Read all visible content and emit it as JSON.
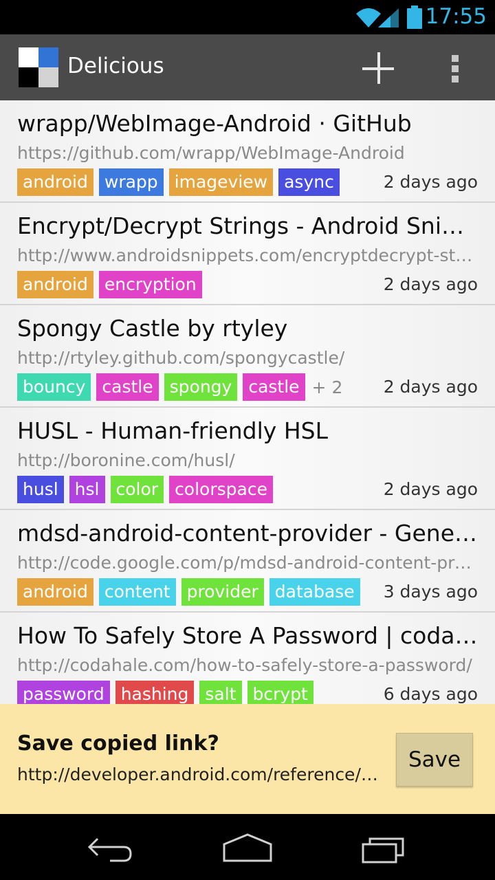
{
  "status_bar": {
    "time": "17:55",
    "icons": [
      "wifi-icon",
      "signal-icon",
      "battery-icon"
    ],
    "accent": "#33b5e5"
  },
  "action_bar": {
    "title": "Delicious",
    "icons": [
      "delicious-logo-icon",
      "add-icon",
      "overflow-menu-icon"
    ],
    "logo_colors": [
      "#3274d6",
      "#000000",
      "#d3d3d3",
      "#ffffff"
    ]
  },
  "tag_colors": {
    "orange": "#e5a43e",
    "blue": "#3c7ae0",
    "indigo": "#4a4ee0",
    "magenta": "#e042c8",
    "teal": "#3ed9b1",
    "green": "#6fe23b",
    "cyan": "#49d3ea",
    "purple": "#b042e0",
    "red": "#e04a4a",
    "violet": "#8a4ee3"
  },
  "bookmarks": [
    {
      "title": "wrapp/WebImage-Android · GitHub",
      "url": "https://github.com/wrapp/WebImage-Android",
      "tags": [
        {
          "label": "android",
          "color": "#e5a43e"
        },
        {
          "label": "wrapp",
          "color": "#3c7ae0"
        },
        {
          "label": "imageview",
          "color": "#e5a43e"
        },
        {
          "label": "async",
          "color": "#4a4ee0"
        }
      ],
      "more": "",
      "date": "2 days ago"
    },
    {
      "title": "Encrypt/Decrypt Strings - Android Snippets",
      "url": "http://www.androidsnippets.com/encryptdecrypt-strings",
      "tags": [
        {
          "label": "android",
          "color": "#e5a43e"
        },
        {
          "label": "encryption",
          "color": "#e042c8"
        }
      ],
      "more": "",
      "date": "2 days ago"
    },
    {
      "title": "Spongy Castle by rtyley",
      "url": "http://rtyley.github.com/spongycastle/",
      "tags": [
        {
          "label": "bouncy",
          "color": "#3ed9b1"
        },
        {
          "label": "castle",
          "color": "#e042c8"
        },
        {
          "label": "spongy",
          "color": "#6fe23b"
        },
        {
          "label": "castle",
          "color": "#e042c8"
        }
      ],
      "more": "+ 2",
      "date": "2 days ago"
    },
    {
      "title": "HUSL - Human-friendly HSL",
      "url": "http://boronine.com/husl/",
      "tags": [
        {
          "label": "husl",
          "color": "#4a4ee0"
        },
        {
          "label": "hsl",
          "color": "#b042e0"
        },
        {
          "label": "color",
          "color": "#6fe23b"
        },
        {
          "label": "colorspace",
          "color": "#e042c8"
        }
      ],
      "more": "",
      "date": "2 days ago"
    },
    {
      "title": "mdsd-android-content-provider - Generator",
      "url": "http://code.google.com/p/mdsd-android-content-provider/",
      "tags": [
        {
          "label": "android",
          "color": "#e5a43e"
        },
        {
          "label": "content",
          "color": "#49d3ea"
        },
        {
          "label": "provider",
          "color": "#6fe23b"
        },
        {
          "label": "database",
          "color": "#49d3ea"
        }
      ],
      "more": "",
      "date": "3 days ago"
    },
    {
      "title": "How To Safely Store A Password | codahale.com",
      "url": "http://codahale.com/how-to-safely-store-a-password/",
      "tags": [
        {
          "label": "password",
          "color": "#b042e0"
        },
        {
          "label": "hashing",
          "color": "#e04a4a"
        },
        {
          "label": "salt",
          "color": "#6fe23b"
        },
        {
          "label": "bcrypt",
          "color": "#6fe23b"
        }
      ],
      "more": "",
      "date": "6 days ago"
    }
  ],
  "save_banner": {
    "heading": "Save copied link?",
    "link": "http://developer.android.com/reference/android/",
    "save_label": "Save",
    "background": "#fbe6a8"
  },
  "nav_bar": {
    "icons": [
      "back-icon",
      "home-icon",
      "recent-apps-icon"
    ]
  }
}
